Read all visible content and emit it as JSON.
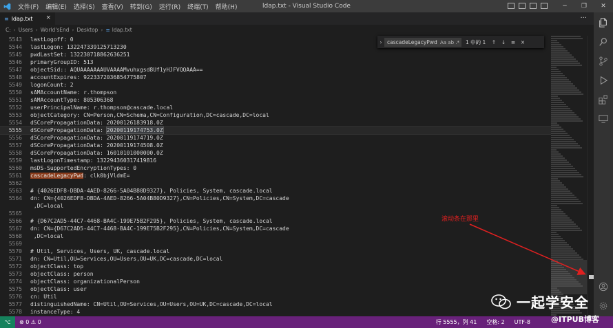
{
  "window": {
    "title": "ldap.txt - Visual Studio Code",
    "menu": [
      "文件(F)",
      "编辑(E)",
      "选择(S)",
      "查看(V)",
      "转到(G)",
      "运行(R)",
      "终端(T)",
      "帮助(H)"
    ]
  },
  "tab": {
    "label": "ldap.txt",
    "close": "×"
  },
  "tab_actions": "···",
  "breadcrumb": [
    "C:",
    "Users",
    "World'sEnd",
    "Desktop",
    "ldap.txt"
  ],
  "find": {
    "query": "cascadeLegacyPwd",
    "options": "Aa  ab  .*",
    "count": "1 中的 1",
    "prev": "↑",
    "next": "↓",
    "selection": "≡",
    "close": "×"
  },
  "editor": {
    "current_line": 5555,
    "lines": [
      {
        "n": "5543",
        "text": "lastLogoff: 0"
      },
      {
        "n": "5544",
        "text": "lastLogon: 132247339125713230"
      },
      {
        "n": "5545",
        "text": "pwdLastSet: 132230718862636251"
      },
      {
        "n": "5546",
        "text": "primaryGroupID: 513"
      },
      {
        "n": "5547",
        "text": "objectSid:: AQUAAAAAAAUVAAAAMvuhxgsd8Uf1yHJFVQQAAA=="
      },
      {
        "n": "5548",
        "text": "accountExpires: 9223372036854775807"
      },
      {
        "n": "5549",
        "text": "logonCount: 2"
      },
      {
        "n": "5550",
        "text": "sAMAccountName: r.thompson"
      },
      {
        "n": "5551",
        "text": "sAMAccountType: 805306368"
      },
      {
        "n": "5552",
        "text": "userPrincipalName: r.thompson@cascade.local"
      },
      {
        "n": "5553",
        "text": "objectCategory: CN=Person,CN=Schema,CN=Configuration,DC=cascade,DC=local"
      },
      {
        "n": "5554",
        "text": "dSCorePropagationData: 20200126183918.0Z"
      },
      {
        "n": "5555",
        "pre": "dSCorePropagationData: ",
        "sel": "20200119174753.0Z",
        "text": ""
      },
      {
        "n": "5556",
        "text": "dSCorePropagationData: 20200119174719.0Z"
      },
      {
        "n": "5557",
        "text": "dSCorePropagationData: 20200119174508.0Z"
      },
      {
        "n": "5558",
        "text": "dSCorePropagationData: 16010101000000.0Z"
      },
      {
        "n": "5559",
        "text": "lastLogonTimestamp: 132294360317419816"
      },
      {
        "n": "5560",
        "text": "msDS-SupportedEncryptionTypes: 0"
      },
      {
        "n": "5561",
        "find": "cascadeLegacyPwd",
        "post": ": clk0bjVldmE=",
        "text": ""
      },
      {
        "n": "5562",
        "text": ""
      },
      {
        "n": "5563",
        "text": "# {4026EDF8-DBDA-4AED-8266-5A04B80D9327}, Policies, System, cascade.local"
      },
      {
        "n": "5564",
        "text": "dn: CN={4026EDF8-DBDA-4AED-8266-5A04B80D9327},CN=Policies,CN=System,DC=cascade"
      },
      {
        "n": "",
        "text": " ,DC=local"
      },
      {
        "n": "5565",
        "text": ""
      },
      {
        "n": "5566",
        "text": "# {D67C2AD5-44C7-4468-BA4C-199E75B2F295}, Policies, System, cascade.local"
      },
      {
        "n": "5567",
        "text": "dn: CN={D67C2AD5-44C7-4468-BA4C-199E75B2F295},CN=Policies,CN=System,DC=cascade"
      },
      {
        "n": "5568",
        "text": " ,DC=local"
      },
      {
        "n": "5569",
        "text": ""
      },
      {
        "n": "5570",
        "text": "# Util, Services, Users, UK, cascade.local"
      },
      {
        "n": "5571",
        "text": "dn: CN=Util,OU=Services,OU=Users,OU=UK,DC=cascade,DC=local"
      },
      {
        "n": "5572",
        "text": "objectClass: top"
      },
      {
        "n": "5573",
        "text": "objectClass: person"
      },
      {
        "n": "5574",
        "text": "objectClass: organizationalPerson"
      },
      {
        "n": "5575",
        "text": "objectClass: user"
      },
      {
        "n": "5576",
        "text": "cn: Util"
      },
      {
        "n": "5577",
        "text": "distinguishedName: CN=Util,OU=Services,OU=Users,OU=UK,DC=cascade,DC=local"
      },
      {
        "n": "5578",
        "text": "instanceType: 4"
      }
    ]
  },
  "statusbar": {
    "remote": "⌥",
    "problems": "⊗ 0 ⚠ 0",
    "cursor": "行 5555，列 41",
    "spaces": "空格: 2",
    "encoding": "UTF-8"
  },
  "annotation": {
    "text": "滚动条在那里",
    "color": "#e02020"
  },
  "watermark": {
    "text": "一起学安全",
    "subtext": "@ITPUB博客"
  },
  "colors": {
    "statusbar": "#68217a",
    "find_highlight": "#8a3b1a",
    "activity_bar": "#333333"
  }
}
